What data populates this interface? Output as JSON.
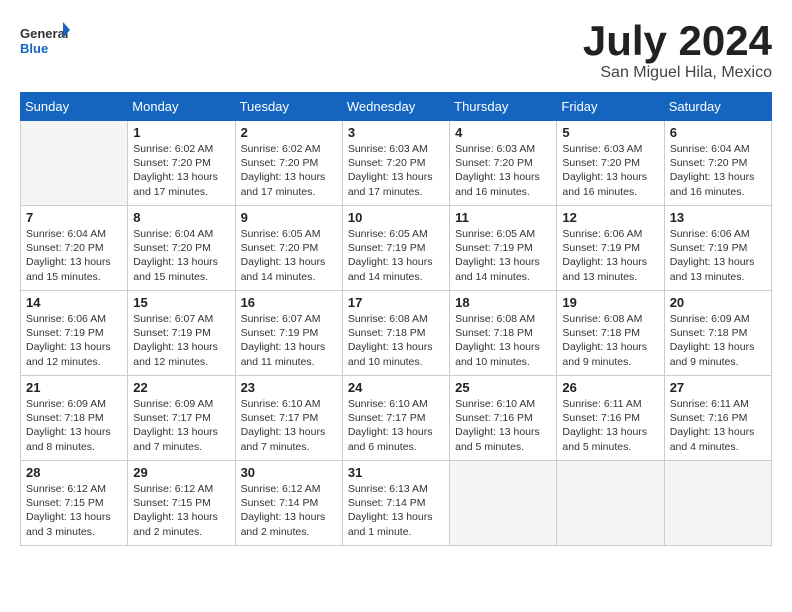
{
  "logo": {
    "general": "General",
    "blue": "Blue"
  },
  "title": "July 2024",
  "location": "San Miguel Hila, Mexico",
  "days_of_week": [
    "Sunday",
    "Monday",
    "Tuesday",
    "Wednesday",
    "Thursday",
    "Friday",
    "Saturday"
  ],
  "weeks": [
    [
      {
        "day": "",
        "info": ""
      },
      {
        "day": "1",
        "info": "Sunrise: 6:02 AM\nSunset: 7:20 PM\nDaylight: 13 hours\nand 17 minutes."
      },
      {
        "day": "2",
        "info": "Sunrise: 6:02 AM\nSunset: 7:20 PM\nDaylight: 13 hours\nand 17 minutes."
      },
      {
        "day": "3",
        "info": "Sunrise: 6:03 AM\nSunset: 7:20 PM\nDaylight: 13 hours\nand 17 minutes."
      },
      {
        "day": "4",
        "info": "Sunrise: 6:03 AM\nSunset: 7:20 PM\nDaylight: 13 hours\nand 16 minutes."
      },
      {
        "day": "5",
        "info": "Sunrise: 6:03 AM\nSunset: 7:20 PM\nDaylight: 13 hours\nand 16 minutes."
      },
      {
        "day": "6",
        "info": "Sunrise: 6:04 AM\nSunset: 7:20 PM\nDaylight: 13 hours\nand 16 minutes."
      }
    ],
    [
      {
        "day": "7",
        "info": "Sunrise: 6:04 AM\nSunset: 7:20 PM\nDaylight: 13 hours\nand 15 minutes."
      },
      {
        "day": "8",
        "info": "Sunrise: 6:04 AM\nSunset: 7:20 PM\nDaylight: 13 hours\nand 15 minutes."
      },
      {
        "day": "9",
        "info": "Sunrise: 6:05 AM\nSunset: 7:20 PM\nDaylight: 13 hours\nand 14 minutes."
      },
      {
        "day": "10",
        "info": "Sunrise: 6:05 AM\nSunset: 7:19 PM\nDaylight: 13 hours\nand 14 minutes."
      },
      {
        "day": "11",
        "info": "Sunrise: 6:05 AM\nSunset: 7:19 PM\nDaylight: 13 hours\nand 14 minutes."
      },
      {
        "day": "12",
        "info": "Sunrise: 6:06 AM\nSunset: 7:19 PM\nDaylight: 13 hours\nand 13 minutes."
      },
      {
        "day": "13",
        "info": "Sunrise: 6:06 AM\nSunset: 7:19 PM\nDaylight: 13 hours\nand 13 minutes."
      }
    ],
    [
      {
        "day": "14",
        "info": "Sunrise: 6:06 AM\nSunset: 7:19 PM\nDaylight: 13 hours\nand 12 minutes."
      },
      {
        "day": "15",
        "info": "Sunrise: 6:07 AM\nSunset: 7:19 PM\nDaylight: 13 hours\nand 12 minutes."
      },
      {
        "day": "16",
        "info": "Sunrise: 6:07 AM\nSunset: 7:19 PM\nDaylight: 13 hours\nand 11 minutes."
      },
      {
        "day": "17",
        "info": "Sunrise: 6:08 AM\nSunset: 7:18 PM\nDaylight: 13 hours\nand 10 minutes."
      },
      {
        "day": "18",
        "info": "Sunrise: 6:08 AM\nSunset: 7:18 PM\nDaylight: 13 hours\nand 10 minutes."
      },
      {
        "day": "19",
        "info": "Sunrise: 6:08 AM\nSunset: 7:18 PM\nDaylight: 13 hours\nand 9 minutes."
      },
      {
        "day": "20",
        "info": "Sunrise: 6:09 AM\nSunset: 7:18 PM\nDaylight: 13 hours\nand 9 minutes."
      }
    ],
    [
      {
        "day": "21",
        "info": "Sunrise: 6:09 AM\nSunset: 7:18 PM\nDaylight: 13 hours\nand 8 minutes."
      },
      {
        "day": "22",
        "info": "Sunrise: 6:09 AM\nSunset: 7:17 PM\nDaylight: 13 hours\nand 7 minutes."
      },
      {
        "day": "23",
        "info": "Sunrise: 6:10 AM\nSunset: 7:17 PM\nDaylight: 13 hours\nand 7 minutes."
      },
      {
        "day": "24",
        "info": "Sunrise: 6:10 AM\nSunset: 7:17 PM\nDaylight: 13 hours\nand 6 minutes."
      },
      {
        "day": "25",
        "info": "Sunrise: 6:10 AM\nSunset: 7:16 PM\nDaylight: 13 hours\nand 5 minutes."
      },
      {
        "day": "26",
        "info": "Sunrise: 6:11 AM\nSunset: 7:16 PM\nDaylight: 13 hours\nand 5 minutes."
      },
      {
        "day": "27",
        "info": "Sunrise: 6:11 AM\nSunset: 7:16 PM\nDaylight: 13 hours\nand 4 minutes."
      }
    ],
    [
      {
        "day": "28",
        "info": "Sunrise: 6:12 AM\nSunset: 7:15 PM\nDaylight: 13 hours\nand 3 minutes."
      },
      {
        "day": "29",
        "info": "Sunrise: 6:12 AM\nSunset: 7:15 PM\nDaylight: 13 hours\nand 2 minutes."
      },
      {
        "day": "30",
        "info": "Sunrise: 6:12 AM\nSunset: 7:14 PM\nDaylight: 13 hours\nand 2 minutes."
      },
      {
        "day": "31",
        "info": "Sunrise: 6:13 AM\nSunset: 7:14 PM\nDaylight: 13 hours\nand 1 minute."
      },
      {
        "day": "",
        "info": ""
      },
      {
        "day": "",
        "info": ""
      },
      {
        "day": "",
        "info": ""
      }
    ]
  ]
}
